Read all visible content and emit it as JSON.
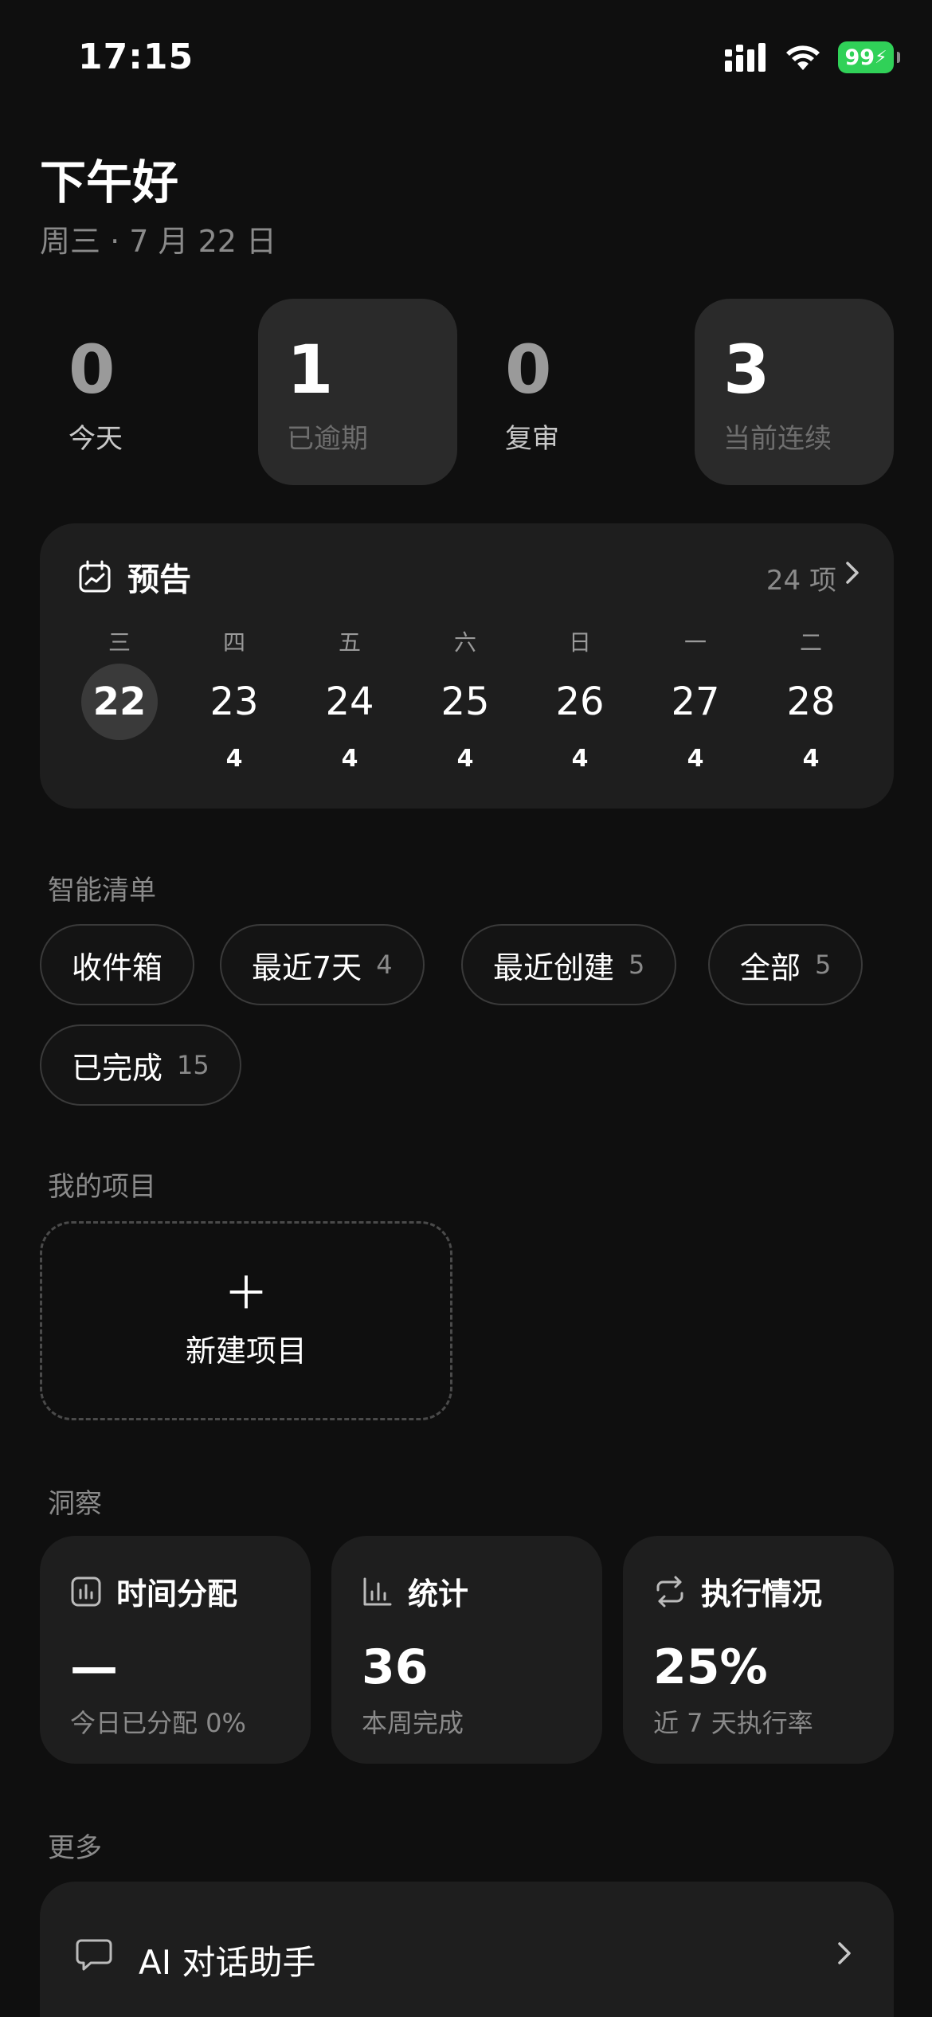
{
  "status": {
    "time": "17:15",
    "battery": "99"
  },
  "greeting": "下午好",
  "date": "周三 · 7 月 22 日",
  "stats": [
    {
      "value": "0",
      "label": "今天",
      "active": false
    },
    {
      "value": "1",
      "label": "已逾期",
      "active": true
    },
    {
      "value": "0",
      "label": "复审",
      "active": false
    },
    {
      "value": "3",
      "label": "当前连续",
      "active": true
    }
  ],
  "forecast": {
    "title": "预告",
    "count": "24 项",
    "days": [
      {
        "weekday": "三",
        "date": "22",
        "count": "",
        "today": true
      },
      {
        "weekday": "四",
        "date": "23",
        "count": "4"
      },
      {
        "weekday": "五",
        "date": "24",
        "count": "4"
      },
      {
        "weekday": "六",
        "date": "25",
        "count": "4"
      },
      {
        "weekday": "日",
        "date": "26",
        "count": "4"
      },
      {
        "weekday": "一",
        "date": "27",
        "count": "4"
      },
      {
        "weekday": "二",
        "date": "28",
        "count": "4"
      }
    ]
  },
  "smart_lists": {
    "title": "智能清单",
    "items": [
      {
        "label": "收件箱",
        "count": ""
      },
      {
        "label": "最近7天",
        "count": "4"
      },
      {
        "label": "最近创建",
        "count": "5"
      },
      {
        "label": "全部",
        "count": "5"
      },
      {
        "label": "已完成",
        "count": "15"
      }
    ]
  },
  "projects": {
    "title": "我的项目",
    "new_label": "新建项目"
  },
  "insights": {
    "title": "洞察",
    "cards": [
      {
        "title": "时间分配",
        "value": "—",
        "sub": "今日已分配 0%",
        "icon": "bar-chart-icon"
      },
      {
        "title": "统计",
        "value": "36",
        "sub": "本周完成",
        "icon": "stats-icon"
      },
      {
        "title": "执行情况",
        "value": "25%",
        "sub": "近 7 天执行率",
        "icon": "repeat-icon"
      }
    ]
  },
  "more": {
    "title": "更多",
    "items": [
      {
        "label": "AI 对话助手",
        "icon": "chat-bubble-icon"
      }
    ]
  }
}
